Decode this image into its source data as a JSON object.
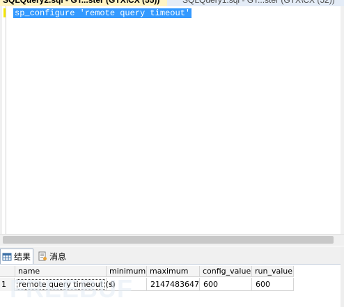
{
  "tabs": {
    "active": "SQLQuery2.sql - GT...ster (GTX\\CX (55))*",
    "inactive": "SQLQuery1.sql - GT...ster (GTX\\CX (52))"
  },
  "editor": {
    "code": "sp_configure 'remote query timeout'"
  },
  "result_tabs": {
    "results": "结果",
    "messages": "消息"
  },
  "grid": {
    "columns": [
      "name",
      "minimum",
      "maximum",
      "config_value",
      "run_value"
    ],
    "rows": [
      {
        "num": "1",
        "cells": [
          "remote query timeout (s)",
          "0",
          "2147483647",
          "600",
          "600"
        ]
      }
    ]
  },
  "watermark": "FREEBUF"
}
